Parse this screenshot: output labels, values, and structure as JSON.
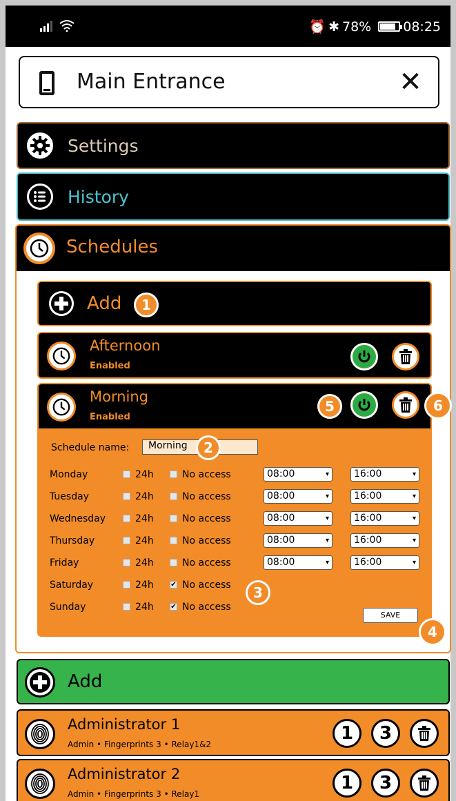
{
  "statusbar": {
    "battery": "78%",
    "time": "08:25"
  },
  "titlebar": {
    "title": "Main Entrance",
    "close": "✕"
  },
  "sections": {
    "settings": "Settings",
    "history": "History",
    "schedules": "Schedules"
  },
  "schedules": {
    "add_label": "Add",
    "items": [
      {
        "name": "Afternoon",
        "state": "Enabled"
      },
      {
        "name": "Morning",
        "state": "Enabled"
      }
    ],
    "form": {
      "name_label": "Schedule name:",
      "name_value": "Morning",
      "opt_24h": "24h",
      "opt_noaccess": "No access",
      "days": [
        {
          "day": "Monday",
          "h24": false,
          "noaccess": false,
          "from": "08:00",
          "to": "16:00"
        },
        {
          "day": "Tuesday",
          "h24": false,
          "noaccess": false,
          "from": "08:00",
          "to": "16:00"
        },
        {
          "day": "Wednesday",
          "h24": false,
          "noaccess": false,
          "from": "08:00",
          "to": "16:00"
        },
        {
          "day": "Thursday",
          "h24": false,
          "noaccess": false,
          "from": "08:00",
          "to": "16:00"
        },
        {
          "day": "Friday",
          "h24": false,
          "noaccess": false,
          "from": "08:00",
          "to": "16:00"
        },
        {
          "day": "Saturday",
          "h24": false,
          "noaccess": true,
          "from": "",
          "to": ""
        },
        {
          "day": "Sunday",
          "h24": false,
          "noaccess": true,
          "from": "",
          "to": ""
        }
      ],
      "save": "SAVE"
    }
  },
  "badges": [
    "1",
    "2",
    "3",
    "4",
    "5",
    "6"
  ],
  "users": {
    "add_label": "Add",
    "items": [
      {
        "name": "Administrator 1",
        "meta": "Admin • Fingerprints 3 • Relay1&2",
        "c1": "1",
        "c2": "3"
      },
      {
        "name": "Administrator 2",
        "meta": "Admin • Fingerprints 3 • Relay1",
        "c1": "1",
        "c2": "3"
      }
    ]
  },
  "colors": {
    "accent": "#f28c28",
    "green": "#36b34a",
    "history": "#49c4d4"
  }
}
